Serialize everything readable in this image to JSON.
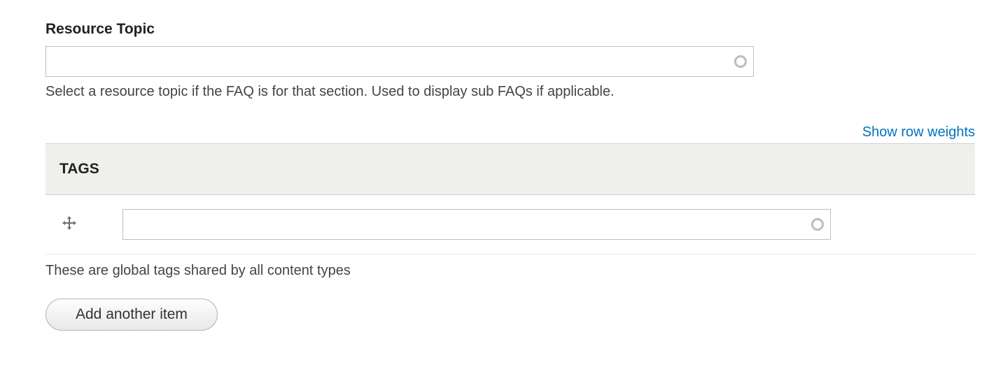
{
  "resource_topic": {
    "label": "Resource Topic",
    "value": "",
    "description": "Select a resource topic if the FAQ is for that section. Used to display sub FAQs if applicable."
  },
  "show_row_weights": "Show row weights",
  "tags": {
    "header": "TAGS",
    "rows": [
      {
        "value": ""
      }
    ],
    "description": "These are global tags shared by all content types"
  },
  "add_another": "Add another item"
}
